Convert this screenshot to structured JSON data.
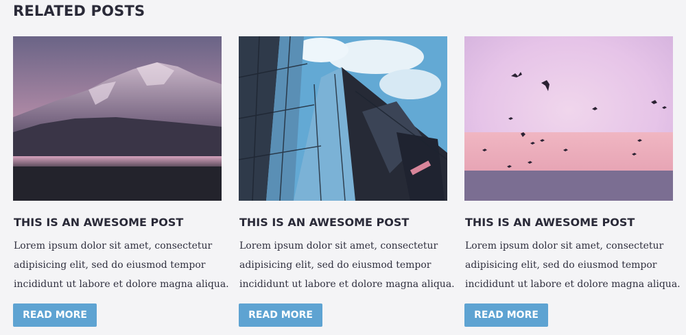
{
  "section": {
    "title": "RELATED POSTS"
  },
  "posts": [
    {
      "image": "mountain-lake-photo",
      "title": "THIS IS AN AWESOME POST",
      "text_lines": [
        "Lorem ipsum dolor sit amet, consectetur",
        "adipisicing elit, sed do eiusmod tempor",
        "incididunt ut labore et dolore magna aliqua."
      ],
      "button_label": "READ MORE"
    },
    {
      "image": "glass-skyscraper-photo",
      "title": "THIS IS AN AWESOME POST",
      "text_lines": [
        "Lorem ipsum dolor sit amet, consectetur",
        "adipisicing elit, sed do eiusmod tempor",
        "incididunt ut labore et dolore magna aliqua."
      ],
      "button_label": "READ MORE"
    },
    {
      "image": "birds-pink-sky-photo",
      "title": "THIS IS AN AWESOME POST",
      "text_lines": [
        "Lorem ipsum dolor sit amet, consectetur",
        "adipisicing elit, sed do eiusmod tempor",
        "incididunt ut labore et dolore magna aliqua."
      ],
      "button_label": "READ MORE"
    }
  ],
  "colors": {
    "background": "#f4f4f6",
    "button": "#5ea3d2",
    "heading": "#2a2a38"
  }
}
